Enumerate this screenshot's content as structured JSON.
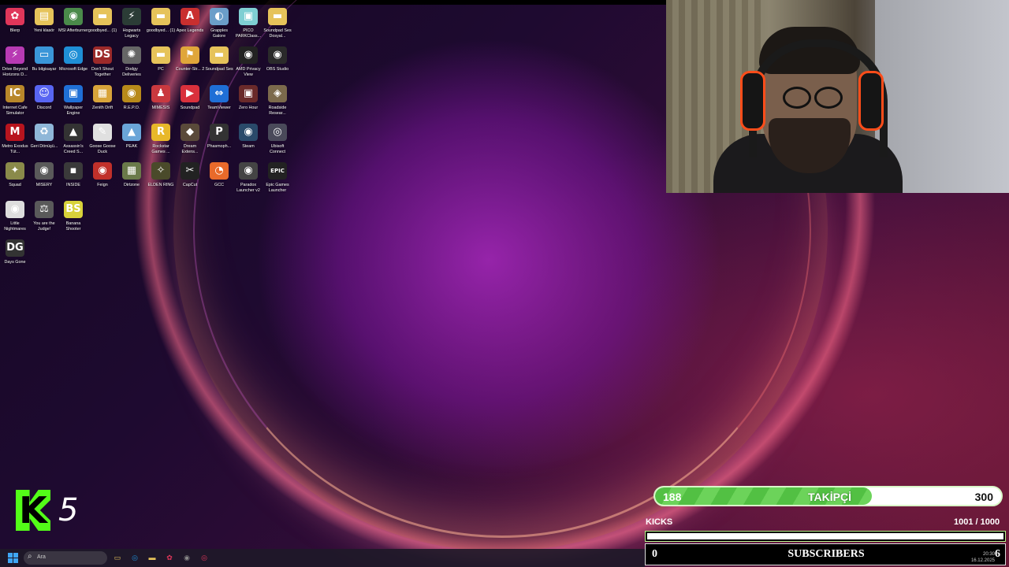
{
  "desktop": {
    "icons": [
      {
        "label": "Blerp",
        "glyph": "✿",
        "color": "#e0365a"
      },
      {
        "label": "Yeni klasör",
        "glyph": "▤",
        "color": "#e6c35a"
      },
      {
        "label": "MSI Afterburner",
        "glyph": "◉",
        "color": "#4a8a4a"
      },
      {
        "label": "goodbyed... (1)",
        "glyph": "▬",
        "color": "#e6c35a"
      },
      {
        "label": "Hogwarts Legacy",
        "glyph": "⚡",
        "color": "#2b3c36"
      },
      {
        "label": "goodbyed... (1)",
        "glyph": "▬",
        "color": "#e6c35a"
      },
      {
        "label": "Apex Legends",
        "glyph": "A",
        "color": "#c92f2f"
      },
      {
        "label": "Grapples Galore",
        "glyph": "◐",
        "color": "#6b9ec9"
      },
      {
        "label": "PICO PARKClass...",
        "glyph": "▣",
        "color": "#7fcfd3"
      },
      {
        "label": "Soundpad Ses Dosyal...",
        "glyph": "▬",
        "color": "#e6c35a"
      },
      {
        "label": "Drive Beyond Horizons D...",
        "glyph": "⚡",
        "color": "#b83ab3"
      },
      {
        "label": "Bu bilgisayar",
        "glyph": "▭",
        "color": "#3a96d8"
      },
      {
        "label": "Microsoft Edge",
        "glyph": "◎",
        "color": "#1f8fd6"
      },
      {
        "label": "Don't Shout Together",
        "glyph": "DS",
        "color": "#9c2a2a"
      },
      {
        "label": "Dodgy Deliveries",
        "glyph": "✺",
        "color": "#666"
      },
      {
        "label": "PC",
        "glyph": "▬",
        "color": "#e6c35a"
      },
      {
        "label": "Counter-Str... 2",
        "glyph": "⚑",
        "color": "#e0a63a"
      },
      {
        "label": "Soundpad Ses",
        "glyph": "▬",
        "color": "#e6c35a"
      },
      {
        "label": "AMD Privacy View",
        "glyph": "◉",
        "color": "#222"
      },
      {
        "label": "OBS Studio",
        "glyph": "◉",
        "color": "#2a2a2a"
      },
      {
        "label": "Internet Cafe Simulator",
        "glyph": "IC",
        "color": "#b8872a"
      },
      {
        "label": "Discord",
        "glyph": "☺",
        "color": "#5865f2"
      },
      {
        "label": "Wallpaper Engine",
        "glyph": "▣",
        "color": "#1f6fd6"
      },
      {
        "label": "Zenith Drift",
        "glyph": "▦",
        "color": "#d8a43a"
      },
      {
        "label": "R.E.P.O.",
        "glyph": "◉",
        "color": "#b88a1a"
      },
      {
        "label": "MIMESIS",
        "glyph": "♟",
        "color": "#c9393f"
      },
      {
        "label": "Soundpad",
        "glyph": "▶",
        "color": "#d9313c"
      },
      {
        "label": "TeamViewer",
        "glyph": "⇔",
        "color": "#1f6fd6"
      },
      {
        "label": "Zero Hour",
        "glyph": "▣",
        "color": "#6a2a2a"
      },
      {
        "label": "Roadside Resear...",
        "glyph": "◈",
        "color": "#7c6a4c"
      },
      {
        "label": "Metro Exodus Tüt...",
        "glyph": "M",
        "color": "#b8141e"
      },
      {
        "label": "Geri Dönüşü...",
        "glyph": "♻",
        "color": "#8fb7d8"
      },
      {
        "label": "Assassin's Creed S...",
        "glyph": "▲",
        "color": "#333"
      },
      {
        "label": "Goose Goose Duck",
        "glyph": "✎",
        "color": "#e0e0e0"
      },
      {
        "label": "PEAK",
        "glyph": "▲",
        "color": "#6aa5d8"
      },
      {
        "label": "Rockstar Games ...",
        "glyph": "R",
        "color": "#e8b82a"
      },
      {
        "label": "Dream Extens...",
        "glyph": "◆",
        "color": "#5a4a3a"
      },
      {
        "label": "Phasmoph...",
        "glyph": "P",
        "color": "#333"
      },
      {
        "label": "Steam",
        "glyph": "◉",
        "color": "#2a4a6a"
      },
      {
        "label": "Ubisoft Connect",
        "glyph": "◎",
        "color": "#4a4a5a"
      },
      {
        "label": "Squad",
        "glyph": "✦",
        "color": "#8a8a4a"
      },
      {
        "label": "MISERY",
        "glyph": "◉",
        "color": "#5a5a5a"
      },
      {
        "label": "INSIDE",
        "glyph": "▪",
        "color": "#3a3a3a"
      },
      {
        "label": "Feign",
        "glyph": "◉",
        "color": "#c0302a"
      },
      {
        "label": "Dirtzone",
        "glyph": "▦",
        "color": "#6a7a4a"
      },
      {
        "label": "ELDEN RING",
        "glyph": "✧",
        "color": "#4a4a2a"
      },
      {
        "label": "CapCut",
        "glyph": "✂",
        "color": "#222"
      },
      {
        "label": "GCC",
        "glyph": "◔",
        "color": "#e86a2a"
      },
      {
        "label": "Paradox Launcher v2",
        "glyph": "◉",
        "color": "#444"
      },
      {
        "label": "Epic Games Launcher",
        "glyph": "EPIC",
        "color": "#222"
      },
      {
        "label": "Little Nightmares",
        "glyph": "◉",
        "color": "#ddd"
      },
      {
        "label": "You are the Judge!",
        "glyph": "⚖",
        "color": "#5a5a5a"
      },
      {
        "label": "Banana Shooter",
        "glyph": "BS",
        "color": "#d8d23a"
      },
      {
        "label": "Days Gone",
        "glyph": "DG",
        "color": "#333"
      }
    ]
  },
  "kick_badge": {
    "count": "5",
    "accent": "#53fc18"
  },
  "follower_goal": {
    "current": "188",
    "label": "TAKİPÇİ",
    "goal": "300",
    "progress": 0.6267
  },
  "kicks_goal": {
    "label": "KICKS",
    "value": "1001  / 1000",
    "progress": 1.0
  },
  "subscribers_goal": {
    "low": "0",
    "label": "SUBSCRIBERS",
    "high": "6"
  },
  "taskbar": {
    "search_placeholder": "Ara",
    "apps": [
      {
        "name": "file-explorer-icon",
        "glyph": "▭",
        "color": "#e6c35a"
      },
      {
        "name": "edge-icon",
        "glyph": "◎",
        "color": "#1f8fd6"
      },
      {
        "name": "folder-icon",
        "glyph": "▬",
        "color": "#e6c35a"
      },
      {
        "name": "blerp-icon",
        "glyph": "✿",
        "color": "#e0365a"
      },
      {
        "name": "obs-icon",
        "glyph": "◉",
        "color": "#888"
      },
      {
        "name": "app-icon",
        "glyph": "◎",
        "color": "#e0365a"
      }
    ],
    "time": "20:30",
    "date": "16.12.2025"
  }
}
